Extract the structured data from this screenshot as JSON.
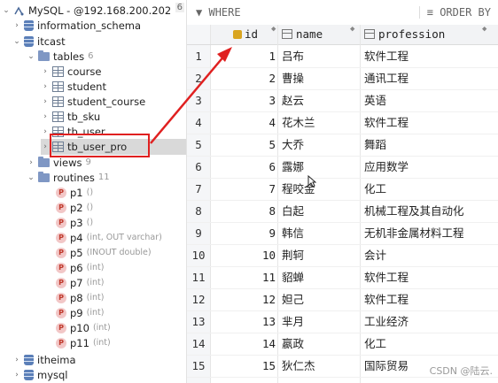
{
  "tree": {
    "connection": {
      "label": "MySQL - @192.168.200.202",
      "badge": "6"
    },
    "items": [
      {
        "label": "information_schema"
      },
      {
        "label": "itcast"
      },
      {
        "label": "tables",
        "count": "6"
      },
      {
        "label": "course"
      },
      {
        "label": "student"
      },
      {
        "label": "student_course"
      },
      {
        "label": "tb_sku"
      },
      {
        "label": "tb_user"
      },
      {
        "label": "tb_user_pro"
      },
      {
        "label": "views",
        "count": "9"
      },
      {
        "label": "routines",
        "count": "11"
      }
    ],
    "routines": [
      {
        "label": "p1",
        "hint": "()"
      },
      {
        "label": "p2",
        "hint": "()"
      },
      {
        "label": "p3",
        "hint": "()"
      },
      {
        "label": "p4",
        "hint": "(int, OUT varchar)"
      },
      {
        "label": "p5",
        "hint": "(INOUT double)"
      },
      {
        "label": "p6",
        "hint": "(int)"
      },
      {
        "label": "p7",
        "hint": "(int)"
      },
      {
        "label": "p8",
        "hint": "(int)"
      },
      {
        "label": "p9",
        "hint": "(int)"
      },
      {
        "label": "p10",
        "hint": "(int)"
      },
      {
        "label": "p11",
        "hint": "(int)"
      }
    ],
    "bottom": [
      {
        "label": "itheima"
      },
      {
        "label": "mysql"
      }
    ]
  },
  "grid": {
    "where_label": "WHERE",
    "order_label": "ORDER BY",
    "columns": [
      {
        "label": "id"
      },
      {
        "label": "name"
      },
      {
        "label": "profession"
      }
    ],
    "rows": [
      {
        "num": "1",
        "id": "1",
        "name": "吕布",
        "profession": "软件工程"
      },
      {
        "num": "2",
        "id": "2",
        "name": "曹操",
        "profession": "通讯工程"
      },
      {
        "num": "3",
        "id": "3",
        "name": "赵云",
        "profession": "英语"
      },
      {
        "num": "4",
        "id": "4",
        "name": "花木兰",
        "profession": "软件工程"
      },
      {
        "num": "5",
        "id": "5",
        "name": "大乔",
        "profession": "舞蹈"
      },
      {
        "num": "6",
        "id": "6",
        "name": "露娜",
        "profession": "应用数学"
      },
      {
        "num": "7",
        "id": "7",
        "name": "程咬金",
        "profession": "化工"
      },
      {
        "num": "8",
        "id": "8",
        "name": "白起",
        "profession": "机械工程及其自动化"
      },
      {
        "num": "9",
        "id": "9",
        "name": "韩信",
        "profession": "无机非金属材料工程"
      },
      {
        "num": "10",
        "id": "10",
        "name": "荆轲",
        "profession": "会计"
      },
      {
        "num": "11",
        "id": "11",
        "name": "貂蝉",
        "profession": "软件工程"
      },
      {
        "num": "12",
        "id": "12",
        "name": "妲己",
        "profession": "软件工程"
      },
      {
        "num": "13",
        "id": "13",
        "name": "芈月",
        "profession": "工业经济"
      },
      {
        "num": "14",
        "id": "14",
        "name": "嬴政",
        "profession": "化工"
      },
      {
        "num": "15",
        "id": "15",
        "name": "狄仁杰",
        "profession": "国际贸易"
      }
    ]
  },
  "watermark": "CSDN @陆云.",
  "colors": {
    "highlight_box": "#e02020",
    "arrow": "#e02020",
    "selected_row": "#d9d9d9"
  }
}
